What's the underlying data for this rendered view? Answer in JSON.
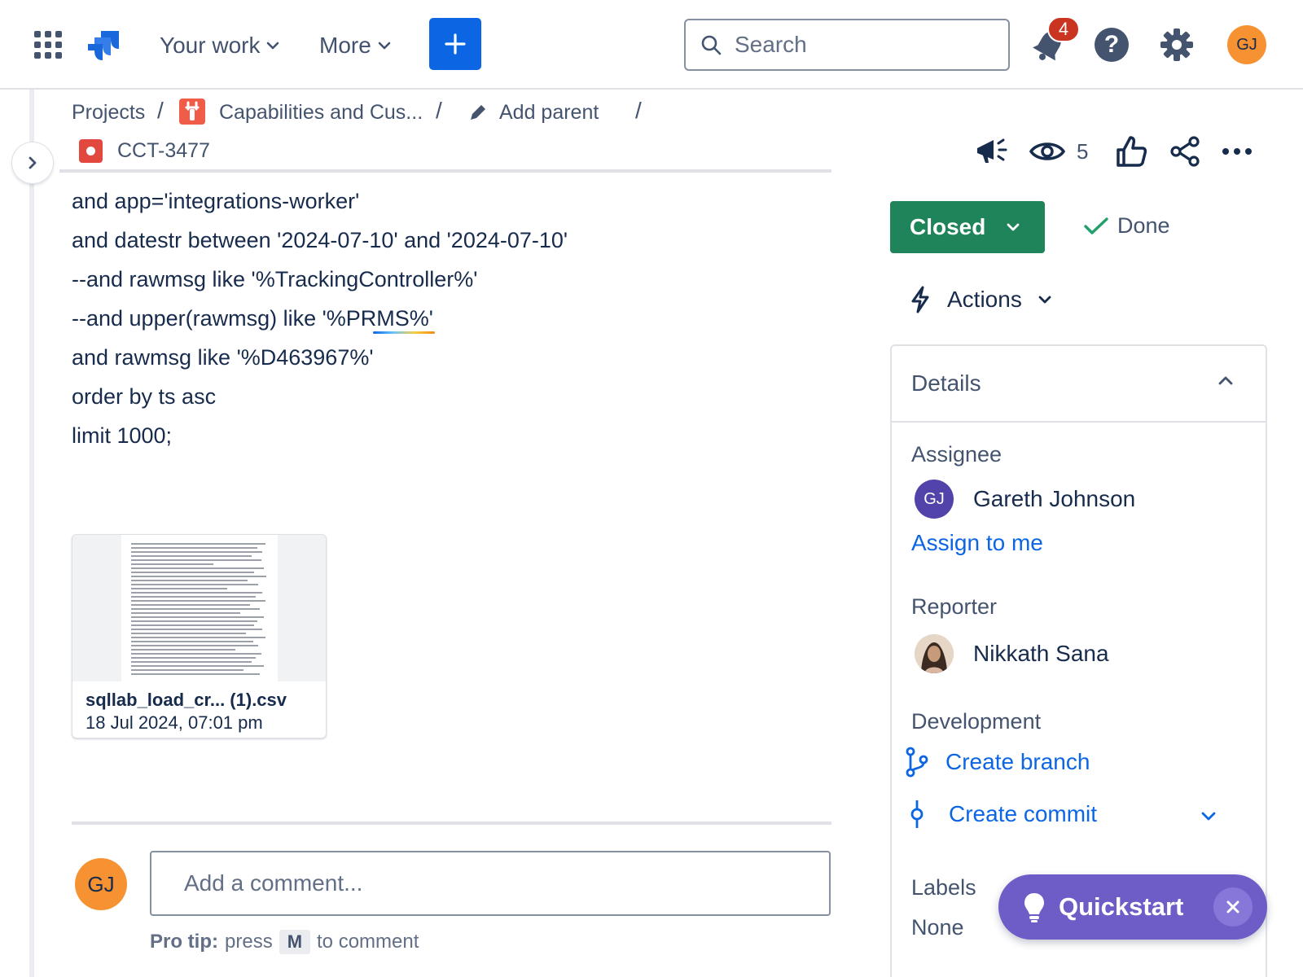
{
  "nav": {
    "your_work": "Your work",
    "more": "More",
    "search_placeholder": "Search",
    "notifications_count": "4",
    "help_glyph": "?",
    "user_initials": "GJ"
  },
  "breadcrumb": {
    "projects": "Projects",
    "project": "Capabilities and Cus...",
    "add_parent": "Add parent",
    "separator": "/",
    "issue_key": "CCT-3477"
  },
  "header_actions": {
    "watchers": "5"
  },
  "description": {
    "lines": [
      "and app='integrations-worker'",
      "and datestr between '2024-07-10' and '2024-07-10'",
      "--and rawmsg like '%TrackingController%'",
      "--and upper(rawmsg) like '%PRMS%'",
      "and rawmsg like '%D463967%'",
      "order by ts asc",
      "limit 1000;"
    ]
  },
  "attachment": {
    "name": "sqllab_load_cr... (1).csv",
    "date": "18 Jul 2024, 07:01 pm"
  },
  "comment": {
    "avatar_initials": "GJ",
    "placeholder": "Add a comment...",
    "pro_tip_label": "Pro tip:",
    "pro_tip_press": "press",
    "pro_tip_key": "M",
    "pro_tip_rest": "to comment"
  },
  "status": {
    "label": "Closed",
    "resolution": "Done",
    "color": "#1f845a"
  },
  "actions": {
    "label": "Actions"
  },
  "details": {
    "title": "Details",
    "assignee_label": "Assignee",
    "assignee_initials": "GJ",
    "assignee_name": "Gareth Johnson",
    "assign_to_me": "Assign to me",
    "reporter_label": "Reporter",
    "reporter_name": "Nikkath Sana",
    "development_label": "Development",
    "create_branch": "Create branch",
    "create_commit": "Create commit",
    "labels_label": "Labels",
    "labels_value": "None"
  },
  "quickstart": {
    "label": "Quickstart",
    "color": "#6e5dc6"
  },
  "icons": [
    "app-switcher-icon",
    "jira-logo-icon",
    "chevron-down-icon",
    "plus-icon",
    "search-icon",
    "bell-icon",
    "help-icon",
    "gear-icon",
    "chevron-right-icon",
    "wrench-icon",
    "pencil-icon",
    "feedback-megaphone-icon",
    "eye-icon",
    "thumbs-up-icon",
    "share-icon",
    "more-icon",
    "check-icon",
    "lightning-icon",
    "chevron-up-icon",
    "branch-icon",
    "commit-icon",
    "lightbulb-icon",
    "close-icon"
  ]
}
